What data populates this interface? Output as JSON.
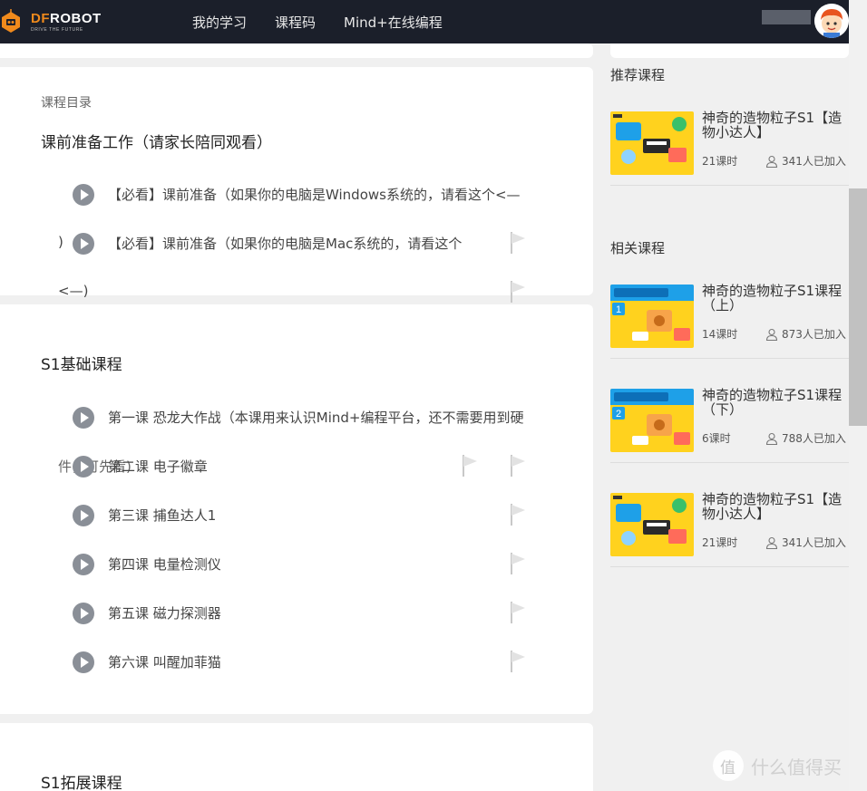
{
  "header": {
    "logo_name_accent": "DF",
    "logo_name_rest": "ROBOT",
    "logo_sub": "DRIVE THE FUTURE",
    "nav": [
      "我的学习",
      "课程码",
      "Mind+在线编程"
    ]
  },
  "catalog": {
    "label": "课程目录",
    "sections": [
      {
        "title": "课前准备工作（请家长陪同观看）",
        "lessons": [
          "【必看】课前准备（如果你的电脑是Windows系统的，请看这个<—",
          "【必看】课前准备（如果你的电脑是Mac系统的，请看这个"
        ],
        "wrap_1": ")",
        "wrap_2": "<—)"
      },
      {
        "title": "S1基础课程",
        "lessons": [
          "第一课 恐龙大作战（本课用来认识Mind+编程平台，还不需要用到硬",
          "第二课 电子徽章",
          "第三课 捕鱼达人1",
          "第四课 电量检测仪",
          "第五课 磁力探测器",
          "第六课 叫醒加菲猫"
        ],
        "wrap_1": "件，可先看)"
      },
      {
        "title": "S1拓展课程",
        "lessons": []
      }
    ]
  },
  "sidebar": {
    "recommended_heading": "推荐课程",
    "recommended": [
      {
        "title": "神奇的造物粒子S1【造物小达人】",
        "hours": "21课时",
        "joined": "341人已加入"
      }
    ],
    "related_heading": "相关课程",
    "related": [
      {
        "title": "神奇的造物粒子S1课程（上）",
        "hours": "14课时",
        "joined": "873人已加入",
        "badge": "1"
      },
      {
        "title": "神奇的造物粒子S1课程（下）",
        "hours": "6课时",
        "joined": "788人已加入",
        "badge": "2"
      },
      {
        "title": "神奇的造物粒子S1【造物小达人】",
        "hours": "21课时",
        "joined": "341人已加入"
      }
    ]
  },
  "watermark": "什么值得买",
  "colors": {
    "topbar": "#1b1f2a",
    "brand_orange": "#f08a1c",
    "play_gray": "#8a8f97",
    "thumb_yellow": "#ffd21e",
    "thumb_blue": "#1ea0e8"
  }
}
